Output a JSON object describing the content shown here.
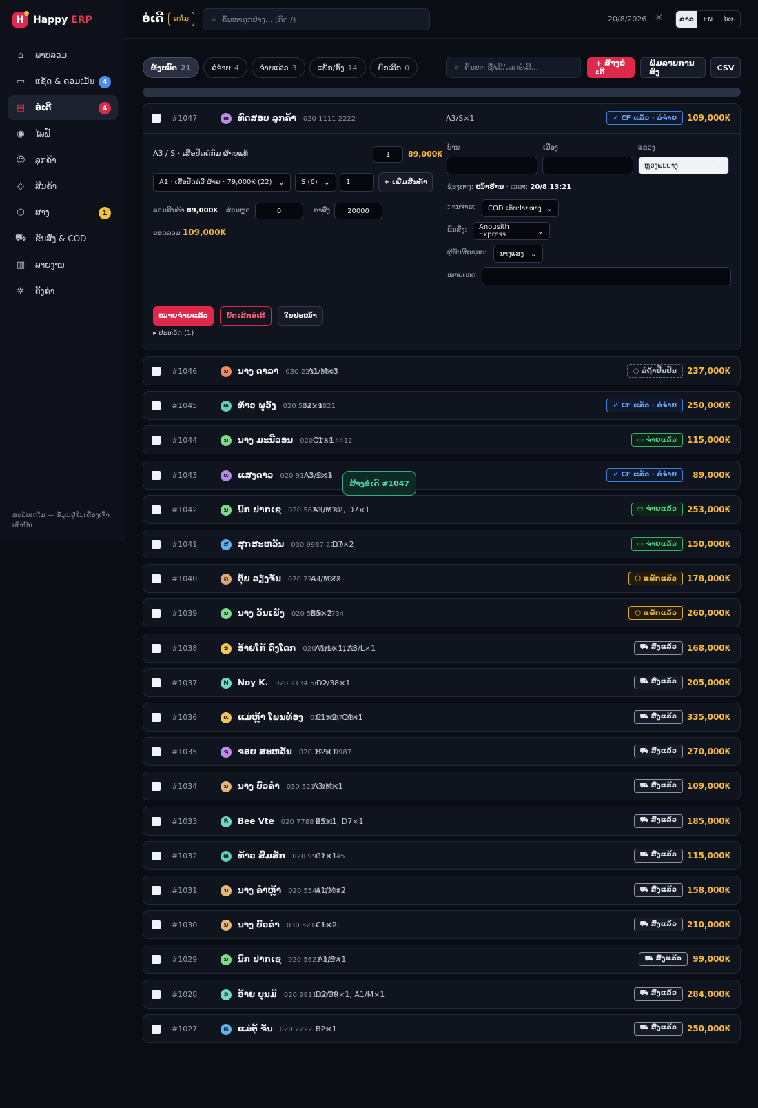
{
  "brand": {
    "logo_letter": "H",
    "name": "Happy",
    "accent": "ERP"
  },
  "nav": [
    {
      "label": "ພາບລວມ",
      "icon": "home-icon",
      "glyph": "⌂"
    },
    {
      "label": "ແຊັດ & ຄອມເມັນ",
      "icon": "chat-icon",
      "glyph": "▭",
      "badge": "4",
      "badge_color": "blue"
    },
    {
      "label": "ອໍເດີ",
      "icon": "receipt-icon",
      "glyph": "▤",
      "badge": "4",
      "badge_color": "red",
      "active": true
    },
    {
      "label": "ໄລຟ໌",
      "icon": "live-icon",
      "glyph": "◉"
    },
    {
      "label": "ລູກຄ້າ",
      "icon": "users-icon",
      "glyph": "☺"
    },
    {
      "label": "ສິນຄ້າ",
      "icon": "tag-icon",
      "glyph": "◇"
    },
    {
      "label": "ສາງ",
      "icon": "box-icon",
      "glyph": "⬡",
      "badge": "1",
      "badge_color": "yellow"
    },
    {
      "label": "ຂົນສົ່ງ & COD",
      "icon": "truck-icon",
      "glyph": "⛟"
    },
    {
      "label": "ລາຍງານ",
      "icon": "bar-chart-icon",
      "glyph": "▥"
    },
    {
      "label": "ຕັ້ງຄ່າ",
      "icon": "gear-icon",
      "glyph": "✲"
    }
  ],
  "sidebar_footer": "ສະບັບເດໂມ — ຂໍ້ມູນຢູ່ໃນເຄື່ອງເຈົ້າເທົ່ານັ້ນ",
  "header": {
    "title": "ອໍເດີ",
    "demo_tag": "ເດໂມ",
    "search_placeholder": "ຄົ້ນຫາທຸກຢ່າງ... (ກົດ /)",
    "date": "20/8/2026",
    "languages": [
      "ລາວ",
      "EN",
      "ໄທຍ"
    ],
    "active_language": "ລາວ"
  },
  "filters": [
    {
      "label": "ທັງໝົດ",
      "count": "21",
      "active": true
    },
    {
      "label": "ລໍຈ່າຍ",
      "count": "4"
    },
    {
      "label": "ຈ່າຍແລ້ວ",
      "count": "3"
    },
    {
      "label": "ແພັກ/ສົ່ງ",
      "count": "14"
    },
    {
      "label": "ຍົກເລີກ",
      "count": "0"
    }
  ],
  "toolbar": {
    "search_placeholder": "ຄົ້ນຫາ ຊື່/ເບີ/ເລກອໍເດີ...",
    "create_label": "+ ສ້າງອໍເດີ",
    "print_label": "ພິມລາຍການສົ່ງ",
    "csv_label": "CSV"
  },
  "colors": {
    "accent": "#e0284a",
    "amount": "#f5b93a",
    "cf_status": "#6fa8ff",
    "paid_status": "#4fd489",
    "packed_status": "#f0c24a"
  },
  "expanded_order": {
    "number": "#1047",
    "avatar": "ທ",
    "avatar_color": "#c18ae8",
    "name": "ທົດສອບ ລູກຄ້າ",
    "phone": "020 1111 2222",
    "items": "A3/S×1",
    "status": "✓ CF ແລ້ວ · ລໍຈ່າຍ",
    "status_icon": "check-icon",
    "amount": "109,000₭",
    "line_item": {
      "title": "A3 / S · ເສື້ອປັດຄໍກົມ ຜ້າຍແທ້",
      "qty": "1",
      "price": "89,000₭"
    },
    "add_product_select": "A1 · ເສື້ອປັດຄໍວີ ຜ້າຍ · 79,000₭ (22)",
    "add_size_select": "S (6)",
    "add_qty": "1",
    "add_button": "+ ເພີ່ມສິນຄ້າ",
    "subtotal_label": "ລວມສິນຄ້າ",
    "subtotal_value": "89,000₭",
    "discount_label": "ສ່ວນຫຼຸດ",
    "discount_value": "0",
    "shipping_label": "ຄ່າສົ່ງ",
    "shipping_value": "20000",
    "total_label": "ຍອດລວມ",
    "total_value": "109,000₭",
    "address_labels": [
      "ບ້ານ",
      "ເມືອງ",
      "ແຂວງ"
    ],
    "province_value": "ຫຼວງພະບາງ",
    "channel_label": "ຊ່ອງທາງ:",
    "channel_value": "ໜ້າຮ້ານ",
    "time_label": "· ເວລາ:",
    "time_value": "20/8 13:21",
    "payment_label": "ການຈ່າຍ:",
    "payment_value": "COD ເກັບປາຍທາງ",
    "carrier_label": "ຂົນສົ່ງ:",
    "carrier_value": "Anousith Express",
    "assignee_label": "ຜູ້ຮັບຜິດຊອບ:",
    "assignee_value": "ນາງແສງ",
    "note_label": "ໝາຍເຫດ",
    "btn_paid": "ໝາຍຈ່າຍແລ້ວ",
    "btn_cancel": "ຍົກເລີກອໍເດີ",
    "btn_invoice": "ໃບປະໜ້າ",
    "history": "▸ ປະຫວັດ (1)"
  },
  "toast": "ສ້າງອໍເດີ #1047",
  "orders": [
    {
      "number": "#1046",
      "avatar": "ນ",
      "avatar_color": "#f08a63",
      "name": "ນາງ ດາລາ",
      "phone": "030 2231 5567",
      "items": "A1/M×3",
      "status": "◌ ລໍຖ້າຢືນຢັນ",
      "status_type": "pending",
      "amount": "237,000₭"
    },
    {
      "number": "#1045",
      "avatar": "ທ",
      "avatar_color": "#5fd0c0",
      "name": "ທ້າວ ພູວົງ",
      "phone": "020 5541 9821",
      "items": "B2×1",
      "status": "✓ CF ແລ້ວ · ລໍຈ່າຍ",
      "status_type": "cf",
      "amount": "250,000₭"
    },
    {
      "number": "#1044",
      "avatar": "ນ",
      "avatar_color": "#7ddc8a",
      "name": "ນາງ ມະນີວອນ",
      "phone": "020 7789 4412",
      "items": "C1×1",
      "status": "▭ ຈ່າຍແລ້ວ",
      "status_type": "paid",
      "amount": "115,000₭"
    },
    {
      "number": "#1043",
      "avatar": "ແ",
      "avatar_color": "#b38ae8",
      "name": "ແສງດາວ",
      "phone": "020 9142 3356",
      "items": "A3/S×1",
      "status": "✓ CF ແລ້ວ · ລໍຈ່າຍ",
      "status_type": "cf",
      "amount": "89,000₭"
    },
    {
      "number": "#1042",
      "avatar": "ນ",
      "avatar_color": "#7ddc8a",
      "name": "ນົກ ປາກເຊ",
      "phone": "020 5623 8874",
      "items": "A3/M×2, D7×1",
      "status": "▭ ຈ່າຍແລ້ວ",
      "status_type": "paid",
      "amount": "253,000₭"
    },
    {
      "number": "#1041",
      "avatar": "ສ",
      "avatar_color": "#5fb3f0",
      "name": "ສຸກສະຫວັນ",
      "phone": "030 9987 2210",
      "items": "D7×2",
      "status": "▭ ຈ່າຍແລ້ວ",
      "status_type": "paid",
      "amount": "150,000₭"
    },
    {
      "number": "#1040",
      "avatar": "ຕ",
      "avatar_color": "#e0a878",
      "name": "ຕຸ້ຍ ວຽງຈັນ",
      "phone": "020 2214 5678",
      "items": "A3/M×2",
      "status": "⬡ ແພັກແລ້ວ",
      "status_type": "packed",
      "amount": "178,000₭"
    },
    {
      "number": "#1039",
      "avatar": "ນ",
      "avatar_color": "#7ddc8a",
      "name": "ນາງ ວັນເພັງ",
      "phone": "020 5590 7734",
      "items": "B5×2",
      "status": "⬡ ແພັກແລ້ວ",
      "status_type": "packed",
      "amount": "260,000₭"
    },
    {
      "number": "#1038",
      "avatar": "ອ",
      "avatar_color": "#f5c55a",
      "name": "ອ້າຍໂກ້ ດົງໂດກ",
      "phone": "020 7456 1123",
      "items": "A1/L×1, A3/L×1",
      "status": "⛟ ສົ່ງແລ້ວ",
      "status_type": "shipped",
      "amount": "168,000₭"
    },
    {
      "number": "#1037",
      "avatar": "N",
      "avatar_color": "#6fd8c8",
      "name": "Noy K.",
      "phone": "020 9134 5622",
      "items": "D2/38×1",
      "status": "⛟ ສົ່ງແລ້ວ",
      "status_type": "shipped",
      "amount": "205,000₭"
    },
    {
      "number": "#1036",
      "avatar": "ແ",
      "avatar_color": "#f5c55a",
      "name": "ແມ່ຫຼ້າ ໂພນທັອງ",
      "phone": "020 5687 3341",
      "items": "C1×2, C4×1",
      "status": "⛟ ສົ່ງແລ້ວ",
      "status_type": "shipped",
      "amount": "335,000₭"
    },
    {
      "number": "#1035",
      "avatar": "ຈ",
      "avatar_color": "#c18ae8",
      "name": "ຈອຍ ສະຫວັນ",
      "phone": "020 2231 9987",
      "items": "B2×1",
      "status": "⛟ ສົ່ງແລ້ວ",
      "status_type": "shipped",
      "amount": "270,000₭"
    },
    {
      "number": "#1034",
      "avatar": "ນ",
      "avatar_color": "#e0b878",
      "name": "ນາງ ບົວຄໍາ",
      "phone": "030 5214 8890",
      "items": "A3/M×1",
      "status": "⛟ ສົ່ງແລ້ວ",
      "status_type": "shipped",
      "amount": "109,000₭"
    },
    {
      "number": "#1033",
      "avatar": "B",
      "avatar_color": "#6fd8c8",
      "name": "Bee Vte",
      "phone": "020 7788 4521",
      "items": "B5×1, D7×1",
      "status": "⛟ ສົ່ງແລ້ວ",
      "status_type": "shipped",
      "amount": "185,000₭"
    },
    {
      "number": "#1032",
      "avatar": "ທ",
      "avatar_color": "#5fd0c0",
      "name": "ທ້າວ ສົມສັກ",
      "phone": "020 9932 1145",
      "items": "C1×1",
      "status": "⛟ ສົ່ງແລ້ວ",
      "status_type": "shipped",
      "amount": "115,000₭"
    },
    {
      "number": "#1031",
      "avatar": "ນ",
      "avatar_color": "#e0b878",
      "name": "ນາງ ຄໍາຫຼ້າ",
      "phone": "020 5541 2233",
      "items": "A1/M×2",
      "status": "⛟ ສົ່ງແລ້ວ",
      "status_type": "shipped",
      "amount": "158,000₭"
    },
    {
      "number": "#1030",
      "avatar": "ນ",
      "avatar_color": "#e0b878",
      "name": "ນາງ ບົວຄໍາ",
      "phone": "030 5214 8890",
      "items": "C1×2",
      "status": "⛟ ສົ່ງແລ້ວ",
      "status_type": "shipped",
      "amount": "210,000₭"
    },
    {
      "number": "#1029",
      "avatar": "ນ",
      "avatar_color": "#7ddc8a",
      "name": "ນົກ ປາກເຊ",
      "phone": "020 5623 8874",
      "items": "A1/S×1",
      "status": "⛟ ສົ່ງແລ້ວ",
      "status_type": "shipped",
      "amount": "99,000₭"
    },
    {
      "number": "#1028",
      "avatar": "ອ",
      "avatar_color": "#6fd8c8",
      "name": "ອ້າຍ ບຸນມີ",
      "phone": "020 9911 0077",
      "items": "D2/39×1, A1/M×1",
      "status": "⛟ ສົ່ງແລ້ວ",
      "status_type": "shipped",
      "amount": "284,000₭"
    },
    {
      "number": "#1027",
      "avatar": "ແ",
      "avatar_color": "#5fb3f0",
      "name": "ແມ່ຕູ້ ຈັນ",
      "phone": "020 2222 3333",
      "items": "B2×1",
      "status": "⛟ ສົ່ງແລ້ວ",
      "status_type": "shipped",
      "amount": "250,000₭"
    }
  ]
}
